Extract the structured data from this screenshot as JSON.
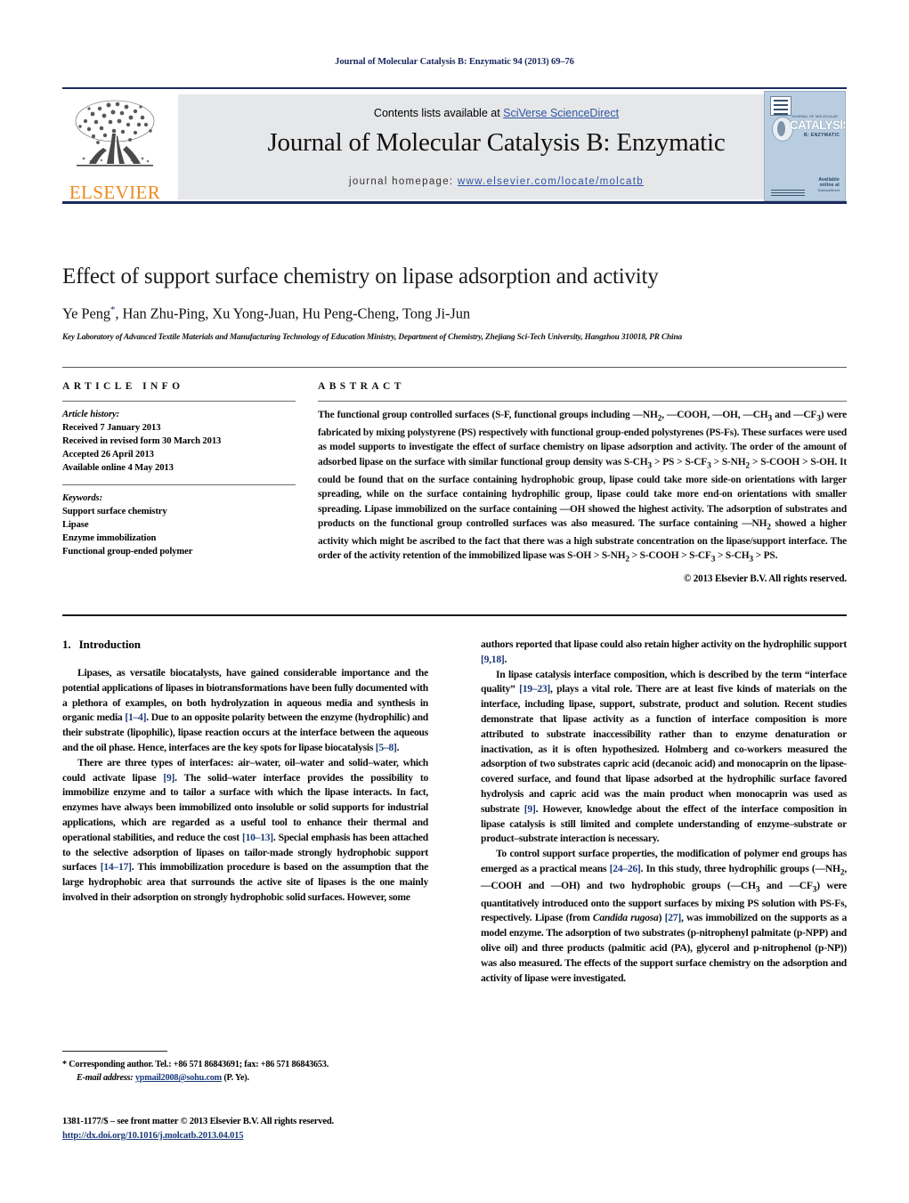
{
  "running_head": "Journal of Molecular Catalysis B: Enzymatic 94 (2013) 69–76",
  "masthead": {
    "contents_prefix": "Contents lists available at ",
    "contents_link": "SciVerse ScienceDirect",
    "journal_title": "Journal of Molecular Catalysis B: Enzymatic",
    "homepage_prefix": "journal homepage: ",
    "homepage_url": "www.elsevier.com/locate/molcatb",
    "publisher": "ELSEVIER",
    "link_color": "#2d54a4",
    "rule_color": "#1a2a5e"
  },
  "cover": {
    "top_line": "JOURNAL OF MOLECULAR",
    "main_line": "CATALYSIS",
    "sub_line": "B: ENZYMATIC",
    "foot_right_bold": "Available online at",
    "foot_right": "ScienceDirect",
    "background": "#b9cde0"
  },
  "article": {
    "title": "Effect of support surface chemistry on lipase adsorption and activity",
    "authors": "Ye Peng",
    "authors_marker": "*",
    "authors_rest": ", Han Zhu-Ping, Xu Yong-Juan, Hu Peng-Cheng, Tong Ji-Jun",
    "affiliation": "Key Laboratory of Advanced Textile Materials and Manufacturing Technology of Education Ministry, Department of Chemistry, Zhejiang Sci-Tech University, Hangzhou 310018, PR China"
  },
  "info": {
    "heading": "ARTICLE INFO",
    "history_title": "Article history:",
    "history": [
      "Received 7 January 2013",
      "Received in revised form 30 March 2013",
      "Accepted 26 April 2013",
      "Available online 4 May 2013"
    ],
    "keywords_title": "Keywords:",
    "keywords": [
      "Support surface chemistry",
      "Lipase",
      "Enzyme immobilization",
      "Functional group-ended polymer"
    ]
  },
  "abstract": {
    "heading": "ABSTRACT",
    "paragraph_1": "The functional group controlled surfaces (S-F, functional groups including —NH",
    "text": "The functional group controlled surfaces (S-F, functional groups including —NH2, —COOH, —OH, —CH3 and —CF3) were fabricated by mixing polystyrene (PS) respectively with functional group-ended polystyrenes (PS-Fs). These surfaces were used as model supports to investigate the effect of surface chemistry on lipase adsorption and activity. The order of the amount of adsorbed lipase on the surface with similar functional group density was S-CH3 > PS > S-CF3 > S-NH2 > S-COOH > S-OH. It could be found that on the surface containing hydrophobic group, lipase could take more side-on orientations with larger spreading, while on the surface containing hydrophilic group, lipase could take more end-on orientations with smaller spreading. Lipase immobilized on the surface containing —OH showed the highest activity. The adsorption of substrates and products on the functional group controlled surfaces was also measured. The surface containing —NH2 showed a higher activity which might be ascribed to the fact that there was a high substrate concentration on the lipase/support interface. The order of the activity retention of the immobilized lipase was S-OH > S-NH2 > S-COOH > S-CF3 > S-CH3 > PS.",
    "copyright": "© 2013 Elsevier B.V. All rights reserved."
  },
  "body": {
    "section_number": "1.",
    "section_title": "Introduction",
    "left_paragraphs": [
      "Lipases, as versatile biocatalysts, have gained considerable importance and the potential applications of lipases in biotransformations have been fully documented with a plethora of examples, on both hydrolyzation in aqueous media and synthesis in organic media [1–4]. Due to an opposite polarity between the enzyme (hydrophilic) and their substrate (lipophilic), lipase reaction occurs at the interface between the aqueous and the oil phase. Hence, interfaces are the key spots for lipase biocatalysis [5–8].",
      "There are three types of interfaces: air–water, oil–water and solid–water, which could activate lipase [9]. The solid–water interface provides the possibility to immobilize enzyme and to tailor a surface with which the lipase interacts. In fact, enzymes have always been immobilized onto insoluble or solid supports for industrial applications, which are regarded as a useful tool to enhance their thermal and operational stabilities, and reduce the cost [10–13]. Special emphasis has been attached to the selective adsorption of lipases on tailor-made strongly hydrophobic support surfaces [14–17]. This immobilization procedure is based on the assumption that the large hydrophobic area that surrounds the active site of lipases is the one mainly involved in their adsorption on strongly hydrophobic solid surfaces. However, some"
    ],
    "right_paragraphs": [
      "authors reported that lipase could also retain higher activity on the hydrophilic support [9,18].",
      "In lipase catalysis interface composition, which is described by the term “interface quality” [19–23], plays a vital role. There are at least five kinds of materials on the interface, including lipase, support, substrate, product and solution. Recent studies demonstrate that lipase activity as a function of interface composition is more attributed to substrate inaccessibility rather than to enzyme denaturation or inactivation, as it is often hypothesized. Holmberg and co-workers measured the adsorption of two substrates capric acid (decanoic acid) and monocaprin on the lipase-covered surface, and found that lipase adsorbed at the hydrophilic surface favored hydrolysis and capric acid was the main product when monocaprin was used as substrate [9]. However, knowledge about the effect of the interface composition in lipase catalysis is still limited and complete understanding of enzyme–substrate or product–substrate interaction is necessary.",
      "To control support surface properties, the modification of polymer end groups has emerged as a practical means [24–26]. In this study, three hydrophilic groups (—NH2, —COOH and —OH) and two hydrophobic groups (—CH3 and —CF3) were quantitatively introduced onto the support surfaces by mixing PS solution with PS-Fs, respectively. Lipase (from Candida rugosa) [27], was immobilized on the supports as a model enzyme. The adsorption of two substrates (p-nitrophenyl palmitate (p-NPP) and olive oil) and three products (palmitic acid (PA), glycerol and p-nitrophenol (p-NP)) was also measured. The effects of the support surface chemistry on the adsorption and activity of lipase were investigated."
    ]
  },
  "footnote": {
    "marker": "*",
    "corresponding": "Corresponding author. Tel.: +86 571 86843691; fax: +86 571 86843653.",
    "email_label": "E-mail address:",
    "email": "ypmail2008@sohu.com",
    "email_owner": "(P. Ye)."
  },
  "imprint": {
    "line1": "1381-1177/$ – see front matter © 2013 Elsevier B.V. All rights reserved.",
    "doi": "http://dx.doi.org/10.1016/j.molcatb.2013.04.015"
  }
}
